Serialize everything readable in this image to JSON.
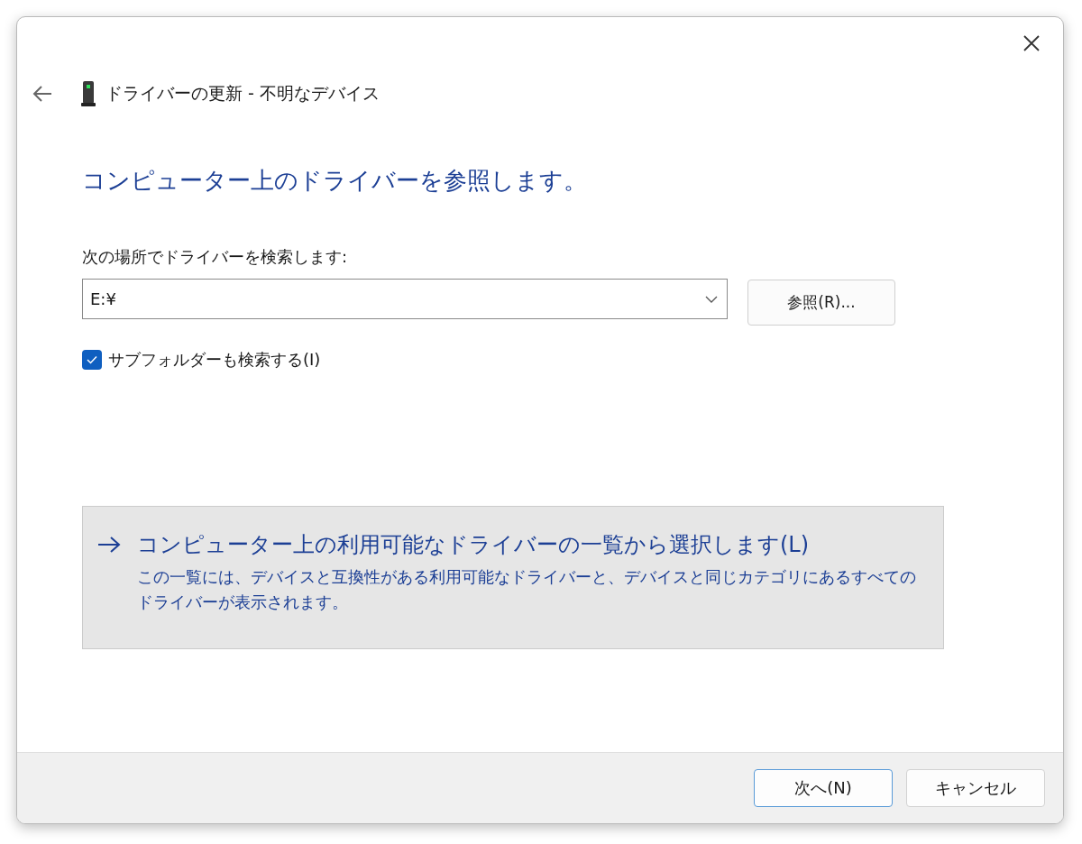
{
  "window": {
    "title": "ドライバーの更新 - 不明なデバイス"
  },
  "heading": "コンピューター上のドライバーを参照します。",
  "search_label": "次の場所でドライバーを検索します:",
  "path_field": {
    "value": "E:¥"
  },
  "browse_button": "参照(R)...",
  "subfolders": {
    "label": "サブフォルダーも検索する(I)",
    "checked": true
  },
  "pick_option": {
    "title": "コンピューター上の利用可能なドライバーの一覧から選択します(L)",
    "description": "この一覧には、デバイスと互換性がある利用可能なドライバーと、デバイスと同じカテゴリにあるすべてのドライバーが表示されます。"
  },
  "buttons": [
    {
      "label": "次へ(N)",
      "default": true
    },
    {
      "label": "キャンセル",
      "default": false
    }
  ]
}
